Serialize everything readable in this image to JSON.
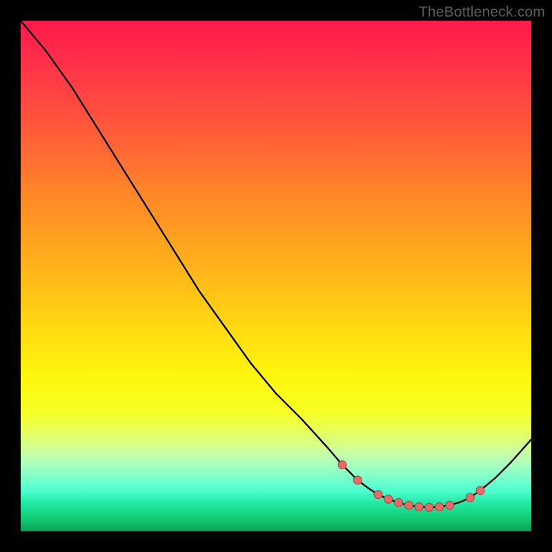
{
  "watermark": "TheBottleneck.com",
  "chart_data": {
    "type": "line",
    "title": "",
    "xlabel": "",
    "ylabel": "",
    "xlim": [
      0,
      100
    ],
    "ylim": [
      0,
      100
    ],
    "grid": false,
    "legend": false,
    "series": [
      {
        "name": "curve",
        "x": [
          0,
          5,
          10,
          15,
          20,
          25,
          30,
          35,
          40,
          45,
          50,
          55,
          60,
          63,
          66,
          68,
          70,
          72,
          74,
          76,
          78,
          80,
          82,
          84,
          86,
          88,
          90,
          93,
          96,
          100
        ],
        "y": [
          100,
          94,
          87,
          79,
          71,
          63,
          55,
          47,
          40,
          33,
          27,
          22,
          16.5,
          13,
          10,
          8.5,
          7.2,
          6.3,
          5.6,
          5.1,
          4.8,
          4.7,
          4.8,
          5.1,
          5.7,
          6.6,
          8.0,
          10.5,
          13.5,
          18
        ]
      }
    ],
    "markers": [
      {
        "x": 63,
        "y": 13
      },
      {
        "x": 66,
        "y": 10
      },
      {
        "x": 70,
        "y": 7.2
      },
      {
        "x": 72,
        "y": 6.3
      },
      {
        "x": 74,
        "y": 5.6
      },
      {
        "x": 76,
        "y": 5.1
      },
      {
        "x": 78,
        "y": 4.8
      },
      {
        "x": 80,
        "y": 4.7
      },
      {
        "x": 82,
        "y": 4.8
      },
      {
        "x": 84,
        "y": 5.1
      },
      {
        "x": 88,
        "y": 6.6
      },
      {
        "x": 90,
        "y": 8.0
      }
    ],
    "gradient_stops": [
      {
        "pct": 0,
        "color": "#ff1a4a"
      },
      {
        "pct": 50,
        "color": "#ffc216"
      },
      {
        "pct": 80,
        "color": "#e9ff55"
      },
      {
        "pct": 100,
        "color": "#0aa356"
      }
    ]
  }
}
